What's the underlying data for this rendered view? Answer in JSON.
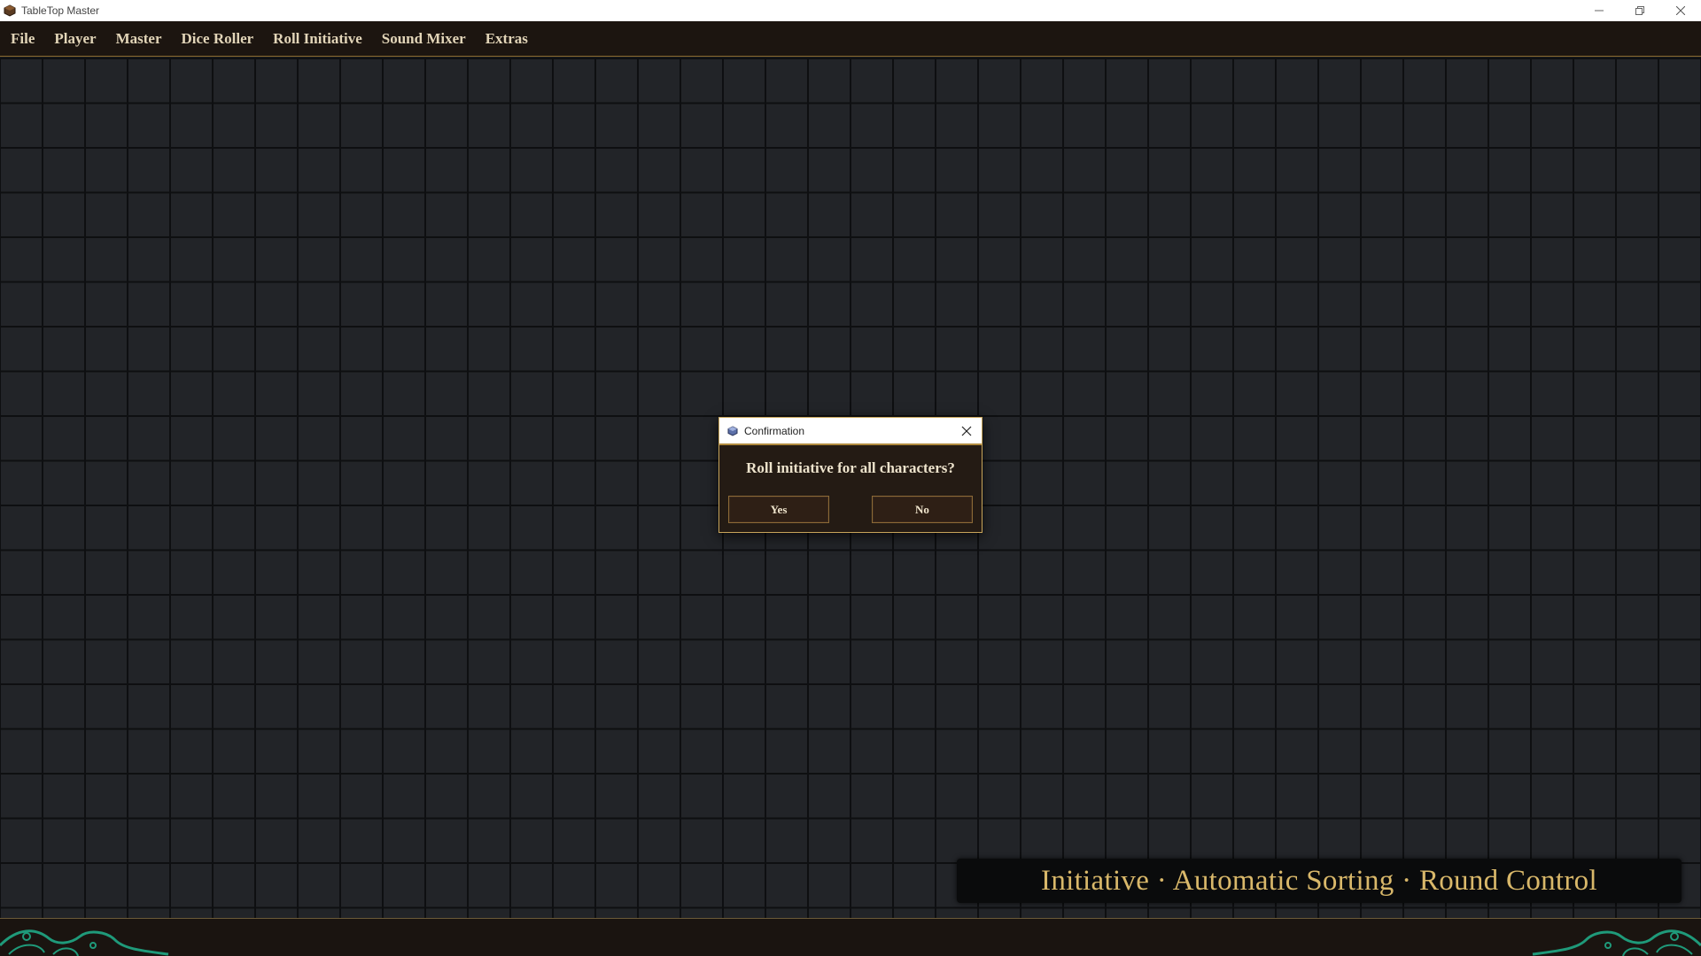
{
  "window": {
    "title": "TableTop Master",
    "icon": "tabletop-app-icon",
    "controls": [
      "minimize-icon",
      "restore-icon",
      "close-icon"
    ]
  },
  "menubar": {
    "items": [
      {
        "label": "File"
      },
      {
        "label": "Player"
      },
      {
        "label": "Master"
      },
      {
        "label": "Dice Roller"
      },
      {
        "label": "Roll Initiative"
      },
      {
        "label": "Sound Mixer"
      },
      {
        "label": "Extras"
      }
    ]
  },
  "dialog": {
    "title": "Confirmation",
    "message": "Roll initiative for all characters?",
    "yes_label": "Yes",
    "no_label": "No"
  },
  "banner": {
    "text": "Initiative · Automatic Sorting · Round Control"
  },
  "colors": {
    "accent_gold": "#d9b86a",
    "menu_bg": "#1c1510",
    "grid_bg": "#222428",
    "ornament": "#1f9a7a"
  }
}
